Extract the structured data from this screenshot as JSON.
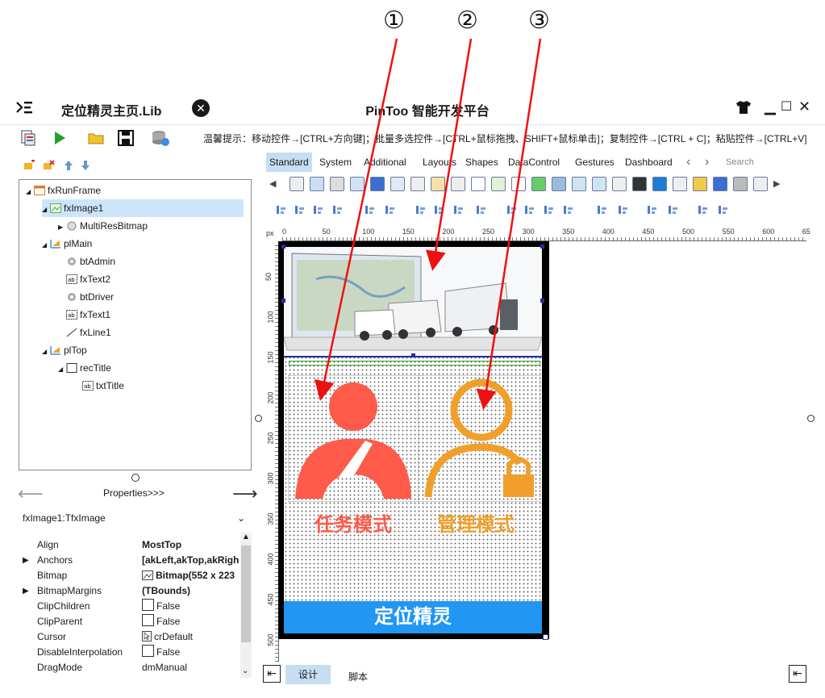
{
  "callouts": [
    "①",
    "②",
    "③"
  ],
  "titlebar": {
    "menu_icon": "☰",
    "lib_title": "定位精灵主页.Lib",
    "close_icon": "✕",
    "app_title": "PinToo 智能开发平台",
    "minimize": "▁",
    "maximize": "☐",
    "close": "✕"
  },
  "toolbar": {
    "tip": "温馨提示：移动控件→[CTRL+方向键]；批量多选控件→[CTRL+鼠标拖拽、SHIFT+鼠标单击]；复制控件→[CTRL + C]；粘贴控件→[CTRL+V]"
  },
  "tree": [
    {
      "label": "fxRunFrame",
      "icon": "frame-icon",
      "depth": 0,
      "expand": "◢"
    },
    {
      "label": "fxImage1",
      "icon": "image-icon",
      "depth": 1,
      "expand": "◢",
      "selected": true
    },
    {
      "label": "MultiResBitmap",
      "icon": "bitmap-icon",
      "depth": 2,
      "expand": "▶"
    },
    {
      "label": "plMain",
      "icon": "layout-icon",
      "depth": 1,
      "expand": "◢"
    },
    {
      "label": "btAdmin",
      "icon": "gear-icon",
      "depth": 2,
      "expand": ""
    },
    {
      "label": "fxText2",
      "icon": "text-icon",
      "depth": 2,
      "expand": ""
    },
    {
      "label": "btDriver",
      "icon": "gear-icon",
      "depth": 2,
      "expand": ""
    },
    {
      "label": "fxText1",
      "icon": "text-icon",
      "depth": 2,
      "expand": ""
    },
    {
      "label": "fxLine1",
      "icon": "line-icon",
      "depth": 2,
      "expand": ""
    },
    {
      "label": "plTop",
      "icon": "layout-icon",
      "depth": 1,
      "expand": "◢"
    },
    {
      "label": "recTitle",
      "icon": "rect-icon",
      "depth": 2,
      "expand": "◢"
    },
    {
      "label": "txtTitle",
      "icon": "text-icon",
      "depth": 3,
      "expand": ""
    }
  ],
  "properties": {
    "header": "Properties>>>",
    "selector": "fxImage1:TfxImage",
    "rows": [
      {
        "name": "Align",
        "value": "MostTop",
        "bold": true,
        "expand": false,
        "check": false
      },
      {
        "name": "Anchors",
        "value": "[akLeft,akTop,akRigh",
        "bold": true,
        "expand": true,
        "check": false
      },
      {
        "name": "Bitmap",
        "value": "Bitmap(552 x 223",
        "bold": true,
        "expand": false,
        "check": false,
        "bitmap": true
      },
      {
        "name": "BitmapMargins",
        "value": "(TBounds)",
        "bold": true,
        "expand": true,
        "check": false
      },
      {
        "name": "ClipChildren",
        "value": "False",
        "bold": false,
        "expand": false,
        "check": true
      },
      {
        "name": "ClipParent",
        "value": "False",
        "bold": false,
        "expand": false,
        "check": true
      },
      {
        "name": "Cursor",
        "value": "crDefault",
        "bold": false,
        "expand": false,
        "check": false,
        "cursor": true
      },
      {
        "name": "DisableInterpolation",
        "value": "False",
        "bold": false,
        "expand": false,
        "check": true
      },
      {
        "name": "DragMode",
        "value": "dmManual",
        "bold": false,
        "expand": false,
        "check": false
      }
    ]
  },
  "palette": {
    "tabs": [
      "Standard",
      "System",
      "Additional",
      "Layouts",
      "Shapes",
      "DataControl",
      "Gestures",
      "Dashboard"
    ],
    "active_tab": "Standard",
    "search_placeholder": "Search"
  },
  "ruler": {
    "unit": "px",
    "h_ticks": [
      "0",
      "50",
      "100",
      "150",
      "200",
      "250",
      "300",
      "350",
      "400",
      "450",
      "500",
      "550",
      "600",
      "65"
    ],
    "v_ticks": [
      "50",
      "100",
      "150",
      "200",
      "250",
      "300",
      "350",
      "400",
      "450",
      "500"
    ]
  },
  "canvas": {
    "mode1": "任务模式",
    "mode2": "管理模式",
    "footer": "定位精灵",
    "colors": {
      "mode1": "#ff5a4a",
      "mode2": "#f0a02a",
      "footer": "#2196f3"
    }
  },
  "bottom_tabs": {
    "design": "设计",
    "script": "脚本"
  }
}
